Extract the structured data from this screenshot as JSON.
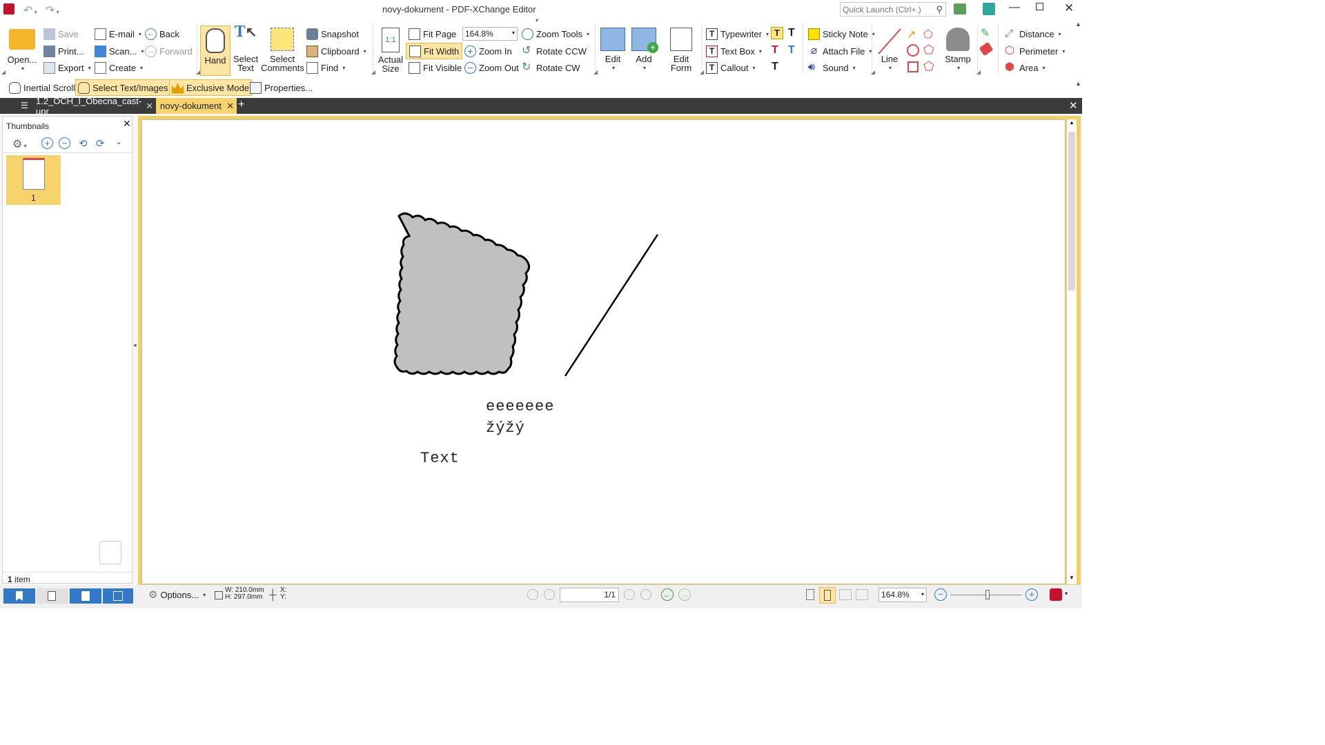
{
  "window": {
    "title": "novy-dokument - PDF-XChange Editor",
    "quick_launch_placeholder": "Quick Launch (Ctrl+.)"
  },
  "ribbon": {
    "open": "Open...",
    "save": "Save",
    "print": "Print...",
    "export": "Export",
    "email": "E-mail",
    "scan": "Scan...",
    "create": "Create",
    "back": "Back",
    "forward": "Forward",
    "hand": "Hand",
    "select_text": "Select Text",
    "select_comments": "Select Comments",
    "snapshot": "Snapshot",
    "clipboard": "Clipboard",
    "find": "Find",
    "actual_size": "Actual Size",
    "fit_page": "Fit Page",
    "fit_width": "Fit Width",
    "fit_visible": "Fit Visible",
    "zoom_value": "164.8%",
    "zoom_tools": "Zoom Tools",
    "zoom_in": "Zoom In",
    "zoom_out": "Zoom Out",
    "rotate_ccw": "Rotate CCW",
    "rotate_cw": "Rotate CW",
    "edit": "Edit",
    "add": "Add",
    "edit_form": "Edit Form",
    "typewriter": "Typewriter",
    "text_box": "Text Box",
    "callout": "Callout",
    "sticky_note": "Sticky Note",
    "attach_file": "Attach File",
    "sound": "Sound",
    "line": "Line",
    "stamp": "Stamp",
    "distance": "Distance",
    "perimeter": "Perimeter",
    "area": "Area"
  },
  "toolbar2": {
    "inertial_scroll": "Inertial Scroll",
    "select_text_images": "Select Text/Images",
    "exclusive_mode": "Exclusive Mode",
    "properties": "Properties..."
  },
  "tabs": [
    {
      "label": "1.2_OCH_I_Obecna_cast-upr",
      "active": false
    },
    {
      "label": "novy-dokument",
      "active": true
    }
  ],
  "thumbnails": {
    "title": "Thumbnails",
    "page_label": "1",
    "count_bold": "1",
    "count_rest": " item"
  },
  "document": {
    "line1": "eeeeeee",
    "line2": "žýžý",
    "line3": "Text"
  },
  "status": {
    "options": "Options...",
    "width": "W: 210.0mm",
    "height": "H: 297.0mm",
    "x": "X:",
    "y": "Y:",
    "page": "1/1",
    "zoom": "164.8%"
  },
  "colors": {
    "accent_yellow": "#f6d36b",
    "tab_bar": "#3b3b3b",
    "active_tab": "#f6d36b",
    "frame_yellow": "#f0cf63"
  }
}
